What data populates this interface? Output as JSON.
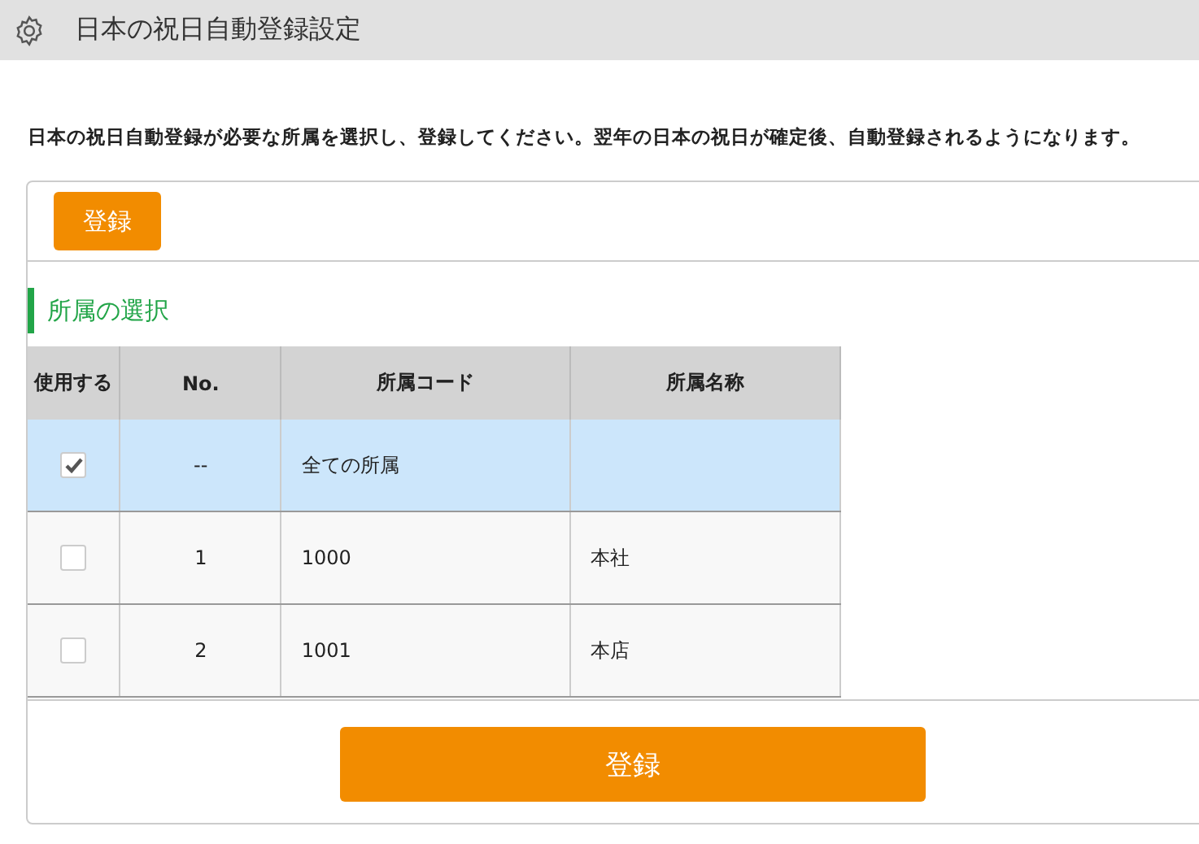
{
  "header": {
    "title": "日本の祝日自動登録設定"
  },
  "instruction": "日本の祝日自動登録が必要な所属を選択し、登録してください。翌年の日本の祝日が確定後、自動登録されるようになります。",
  "top_button": "登録",
  "section_title": "所属の選択",
  "table": {
    "columns": [
      "使用する",
      "No.",
      "所属コード",
      "所属名称"
    ],
    "rows": [
      {
        "checked": true,
        "no": "--",
        "code": "全ての所属"
      },
      {
        "checked": false,
        "no": "1",
        "code": "1000",
        "name": "本社"
      },
      {
        "checked": false,
        "no": "2",
        "code": "1001",
        "name": "本店"
      }
    ]
  },
  "bottom_button": "登録"
}
